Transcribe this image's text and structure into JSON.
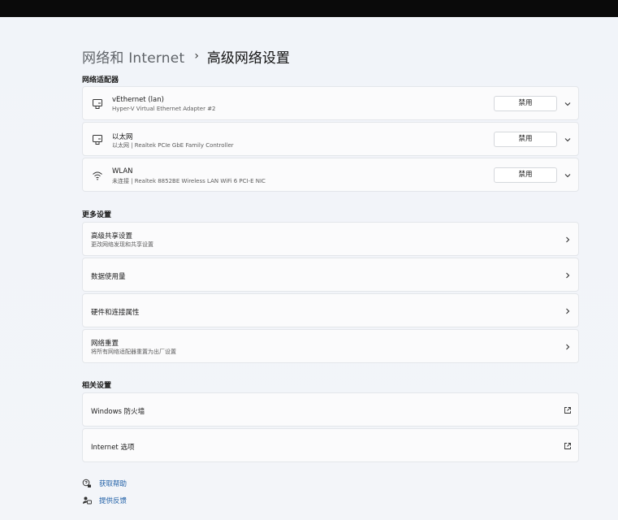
{
  "breadcrumb": {
    "parent": "网络和 Internet",
    "separator": "›",
    "current": "高级网络设置"
  },
  "sections": {
    "adapters_title": "网络适配器",
    "more_title": "更多设置",
    "related_title": "相关设置"
  },
  "adapters": [
    {
      "name": "vEthernet (lan)",
      "desc": "Hyper-V Virtual Ethernet Adapter #2",
      "button": "禁用",
      "icon": "ethernet-icon"
    },
    {
      "name": "以太网",
      "desc": "以太网 | Realtek PCIe GbE Family Controller",
      "button": "禁用",
      "icon": "ethernet-icon"
    },
    {
      "name": "WLAN",
      "desc": "未连接 | Realtek 8852BE Wireless LAN WiFi 6 PCI-E NIC",
      "button": "禁用",
      "icon": "wifi-icon"
    }
  ],
  "more_settings": [
    {
      "title": "高级共享设置",
      "sub": "更改网络发现和共享设置"
    },
    {
      "title": "数据使用量",
      "sub": ""
    },
    {
      "title": "硬件和连接属性",
      "sub": ""
    },
    {
      "title": "网络重置",
      "sub": "将所有网络适配器重置为出厂设置"
    }
  ],
  "related_settings": [
    {
      "title": "Windows 防火墙",
      "icon": "open-external-icon"
    },
    {
      "title": "Internet 选项",
      "icon": "open-external-icon"
    }
  ],
  "help": {
    "get_help": "获取帮助",
    "feedback": "提供反馈"
  },
  "colors": {
    "accent_link": "#1f5fa6",
    "background": "#eef2f8",
    "card": "#fbfbfc"
  }
}
